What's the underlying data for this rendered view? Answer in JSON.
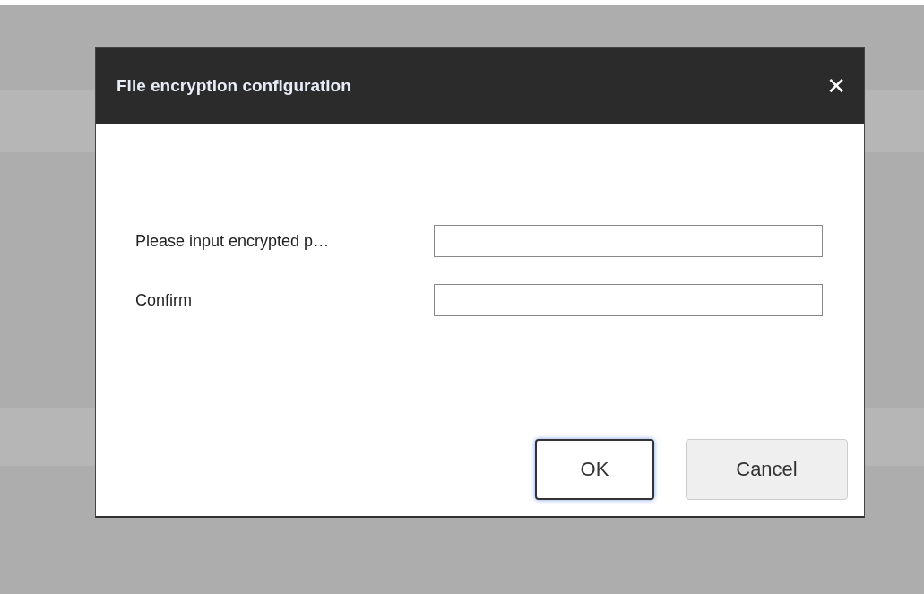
{
  "dialog": {
    "title": "File encryption configuration",
    "close": "✕",
    "fields": [
      {
        "label": "Please input encrypted p…"
      },
      {
        "label": "Confirm"
      }
    ],
    "buttons": [
      {
        "label": "OK",
        "focused": true
      },
      {
        "label": "Cancel",
        "focused": false
      }
    ]
  }
}
